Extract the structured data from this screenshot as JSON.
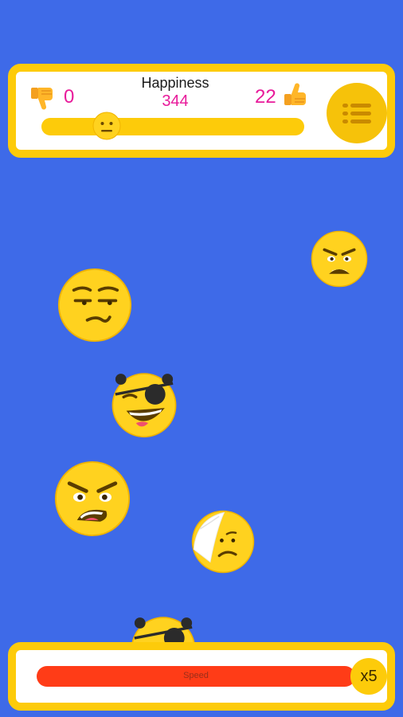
{
  "hud": {
    "title": "Happiness",
    "happiness_value": "344",
    "dislike_count": "0",
    "like_count": "22",
    "happiness_level": 0.26
  },
  "speed": {
    "label": "Speed",
    "multiplier": "x5"
  },
  "colors": {
    "background": "#3E6AE8",
    "accent_yellow": "#FDCB0A",
    "count_pink": "#E81A9A",
    "speed_red": "#FF3C17"
  },
  "emojis": [
    "angry-face",
    "smirk-face",
    "pirate-laughing-face",
    "angry-shouting-face",
    "bandaged-sad-face",
    "pirate-face-partial"
  ]
}
